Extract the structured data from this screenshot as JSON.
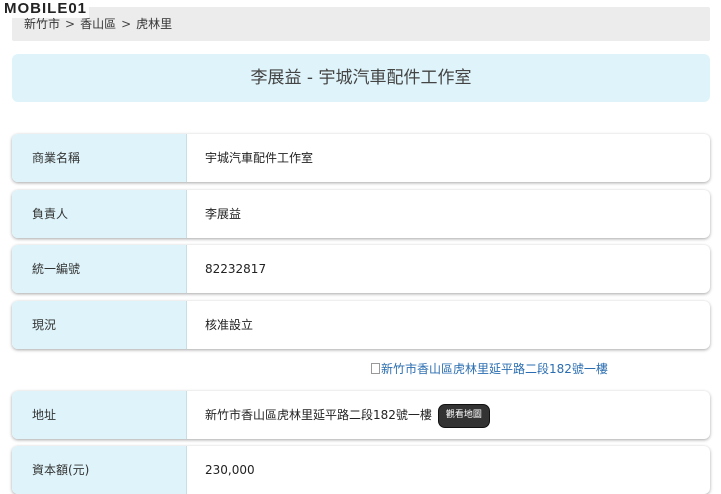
{
  "logo": {
    "text": "MOBILE01"
  },
  "breadcrumb": {
    "items": [
      "新竹市",
      "香山區",
      "虎林里"
    ],
    "separator": ">"
  },
  "title": "李展益 - 宇城汽車配件工作室",
  "rows": [
    {
      "label": "商業名稱",
      "value": "宇城汽車配件工作室"
    },
    {
      "label": "負責人",
      "value": "李展益"
    },
    {
      "label": "統一編號",
      "value": "82232817"
    },
    {
      "label": "現況",
      "value": "核准設立"
    }
  ],
  "map_image_alt": "新竹市香山區虎林里延平路二段182號一樓",
  "address": {
    "label": "地址",
    "value": "新竹市香山區虎林里延平路二段182號一樓",
    "button": "觀看地圖"
  },
  "capital": {
    "label": "資本額(元)",
    "value": "230,000"
  },
  "colors": {
    "label_bg": "#dff4fa",
    "breadcrumb_bg": "#ececec",
    "button_bg": "#333333",
    "link": "#2a6db0"
  }
}
